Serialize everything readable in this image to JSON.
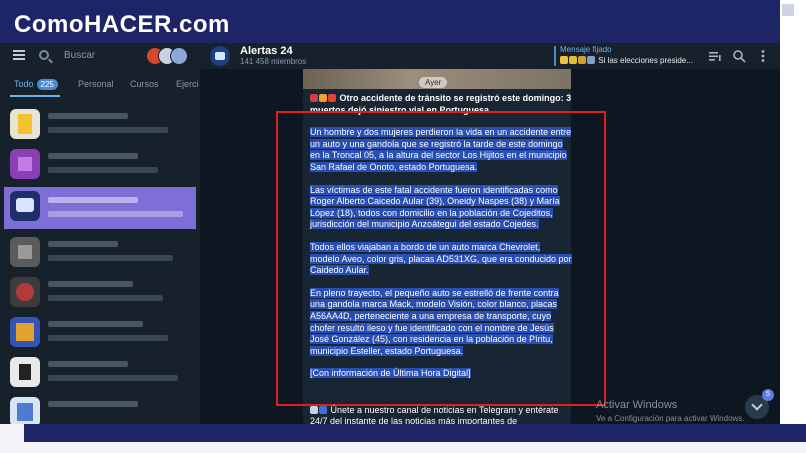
{
  "brand": {
    "logo_text": "ComoHACER.com"
  },
  "sidebar": {
    "search_placeholder": "Buscar",
    "tabs": [
      {
        "label": "Todo",
        "badge": "225"
      },
      {
        "label": "Personal"
      },
      {
        "label": "Cursos"
      },
      {
        "label": "Ejerci"
      }
    ]
  },
  "header": {
    "channel_name": "Alertas 24",
    "subscribers": "141 458 miembros",
    "pinned_label": "Mensaje fijado",
    "pinned_text": "Si las elecciones preside..."
  },
  "chat": {
    "date_label": "Ayer",
    "message": {
      "headline": "Otro accidente de tránsito se registró  este domingo: 3 muertos dejó siniestro vial en Portuguesa",
      "p1": "Un hombre y dos mujeres perdieron la vida en un accidente entre un auto y una gandola que se registró la tarde de este domingo en la Troncal 05, a la altura del sector Los Hijitos en el municipio San Rafael de Onoto, estado Portuguesa.",
      "p2": "Las víctimas de este fatal accidente fueron identificadas como Roger Alberto Caicedo Aular (39), Oneidy Naspes (38) y María López (18), todos con domicilio en la población de Cojeditos, jurisdicción del municipio Anzoátegui del estado Cojedes.",
      "p3": "Todos ellos viajaban a bordo de un auto marca Chevrolet, modelo Aveo, color gris, placas AD531XG, que era conducido por Caidedo Aular.",
      "p4": "En pleno trayecto, el pequeño auto se estrelló de frente contra una gandola marca Mack, modelo Visión, color blanco, placas A56AA4D, perteneciente a una empresa de transporte, cuyo chofer resultó ileso y fue identificado con el nombre de Jesús José González (45), con residencia en la población de Píritu, municipio Esteller, estado Portuguesa.",
      "p5": "[Con información de Última Hora Digital]"
    },
    "next_message": "Únete a nuestro canal de noticias en Telegram y entérate 24/7 del instante de las noticias más importantes de"
  },
  "windows_notice": {
    "title": "Activar Windows",
    "subtitle": "Ve a Configuración para activar Windows."
  },
  "scroll_badge": "5",
  "colors": {
    "brand_navy": "#1d2567",
    "selection_highlight": "#2a4fb3",
    "annotation_red": "#e02020",
    "selected_chat": "#7e6fd6"
  }
}
